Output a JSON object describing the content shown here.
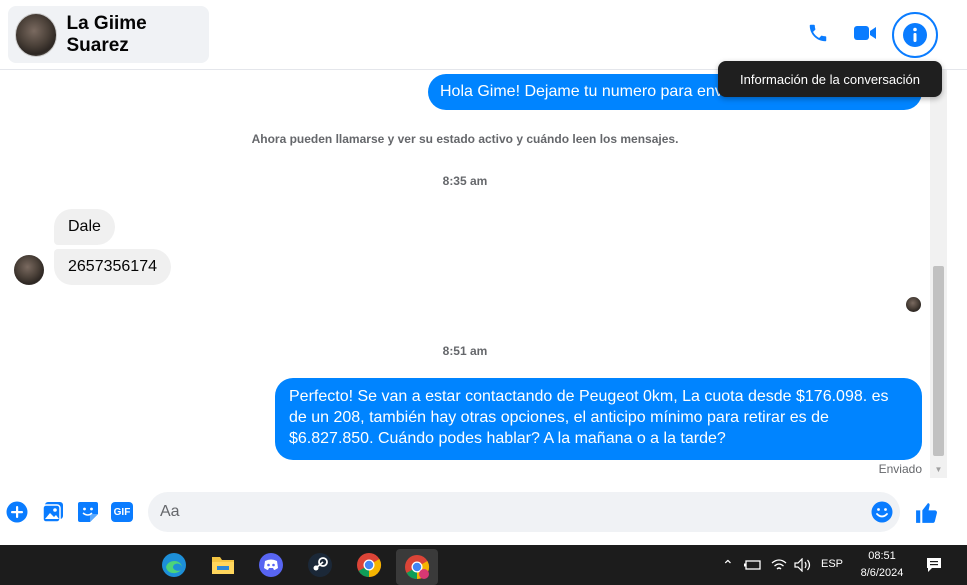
{
  "header": {
    "contact_name": "La Giime Suarez",
    "icons": [
      "phone-icon",
      "video-icon",
      "info-icon"
    ]
  },
  "tooltip": {
    "text": "Información de la conversación"
  },
  "messages": {
    "first_outgoing": "Hola Gime! Dejame tu numero para enviarte toda la información",
    "system_notice": "Ahora pueden llamarse y ver su estado activo y cuándo leen los mensajes.",
    "time_1": "8:35 am",
    "incoming_1": "Dale",
    "incoming_2": "2657356174",
    "time_2": "8:51 am",
    "outgoing_2": "Perfecto!  Se van a estar contactando de Peugeot 0km, La cuota desde $176.098. es de un 208, también hay otras opciones, el anticipo mínimo para retirar es de $6.827.850. Cuándo podes hablar? A la mañana o a la tarde?",
    "status": "Enviado"
  },
  "composer": {
    "placeholder": "Aa",
    "icons": [
      "plus-icon",
      "image-icon",
      "sticker-icon",
      "gif-icon",
      "emoji-icon",
      "like-icon"
    ],
    "gif_label": "GIF"
  },
  "taskbar": {
    "language": "ESP",
    "time": "08:51",
    "date": "8/6/2024"
  },
  "colors": {
    "accent": "#0084ff",
    "icon_blue": "#0a7cff",
    "incoming_bubble": "#f0f0f0",
    "taskbar": "#1c1c1c"
  }
}
